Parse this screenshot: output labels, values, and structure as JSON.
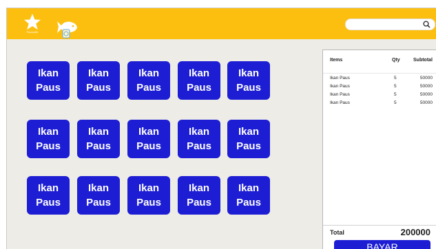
{
  "header": {
    "favorite_label": "Favourite",
    "search": {
      "value": "",
      "placeholder": ""
    }
  },
  "menu": {
    "items": [
      {
        "label": "Ikan\nPaus"
      },
      {
        "label": "Ikan\nPaus"
      },
      {
        "label": "Ikan\nPaus"
      },
      {
        "label": "Ikan\nPaus"
      },
      {
        "label": "Ikan\nPaus"
      },
      {
        "label": "Ikan\nPaus"
      },
      {
        "label": "Ikan\nPaus"
      },
      {
        "label": "Ikan\nPaus"
      },
      {
        "label": "Ikan\nPaus"
      },
      {
        "label": "Ikan\nPaus"
      },
      {
        "label": "Ikan\nPaus"
      },
      {
        "label": "Ikan\nPaus"
      },
      {
        "label": "Ikan\nPaus"
      },
      {
        "label": "Ikan\nPaus"
      },
      {
        "label": "Ikan\nPaus"
      }
    ]
  },
  "cart": {
    "headers": {
      "items": "Items",
      "qty": "Qty",
      "subtotal": "Subtotal"
    },
    "rows": [
      {
        "item": "Ikan Paus",
        "qty": "5",
        "subtotal": "50000"
      },
      {
        "item": "Ikan Paus",
        "qty": "5",
        "subtotal": "50000"
      },
      {
        "item": "Ikan Paus",
        "qty": "5",
        "subtotal": "50000"
      },
      {
        "item": "Ikan Paus",
        "qty": "5",
        "subtotal": "50000"
      }
    ],
    "total_label": "Total",
    "total_value": "200000",
    "pay_label": "BAYAR"
  },
  "colors": {
    "header": "#fdbf0f",
    "tile": "#1d1ed3",
    "background": "#eeece7"
  },
  "icons": {
    "favorite": "star-icon",
    "fish": "fish-icon",
    "search": "search-icon"
  }
}
